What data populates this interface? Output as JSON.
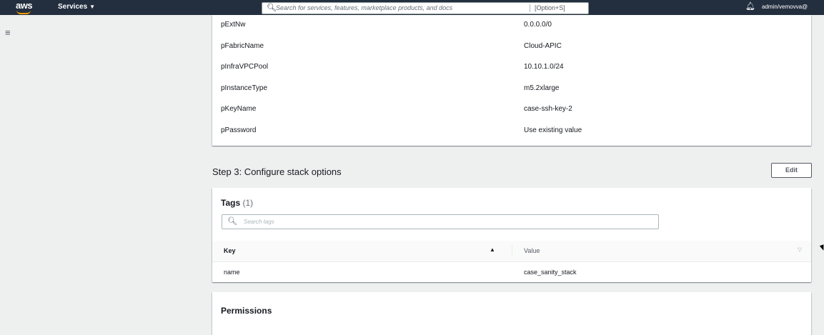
{
  "header": {
    "logo": "aws",
    "services_label": "Services",
    "search_placeholder": "Search for services, features, marketplace products, and docs",
    "search_shortcut": "[Option+S]",
    "account_label": "admin/vemovva@"
  },
  "parameters": [
    {
      "key": "pExtNw",
      "value": "0.0.0.0/0"
    },
    {
      "key": "pFabricName",
      "value": "Cloud-APIC"
    },
    {
      "key": "pInfraVPCPool",
      "value": "10.10.1.0/24"
    },
    {
      "key": "pInstanceType",
      "value": "m5.2xlarge"
    },
    {
      "key": "pKeyName",
      "value": "case-ssh-key-2"
    },
    {
      "key": "pPassword",
      "value": "Use existing value"
    }
  ],
  "step3": {
    "title": "Step 3: Configure stack options",
    "edit_label": "Edit"
  },
  "tags": {
    "title": "Tags",
    "count": "(1)",
    "search_placeholder": "Search tags",
    "columns": {
      "key": "Key",
      "value": "Value"
    },
    "rows": [
      {
        "key": "name",
        "value": "case_sanity_stack"
      }
    ]
  },
  "permissions": {
    "title": "Permissions"
  },
  "icons": {
    "search": "search-icon",
    "bell": "bell-icon",
    "menu": "hamburger-menu-icon",
    "sort_asc": "sort-ascending-icon",
    "sort_desc": "sort-descending-icon"
  },
  "colors": {
    "nav_bg": "#232f3e",
    "brand_accent": "#ff9900",
    "page_bg": "#eef0f0"
  }
}
